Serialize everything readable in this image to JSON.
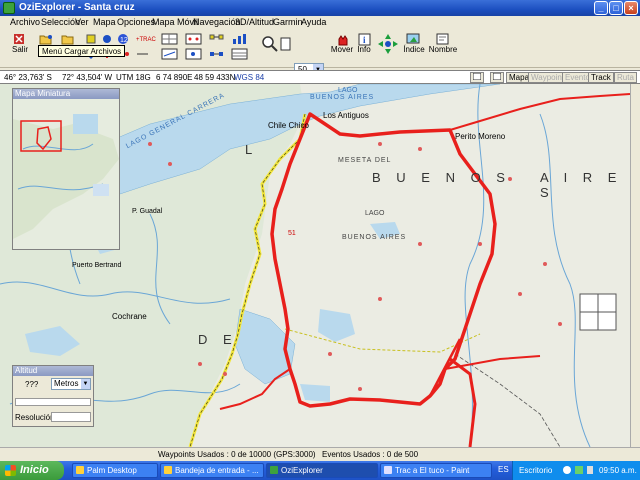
{
  "window": {
    "title": "OziExplorer - Santa cruz"
  },
  "menubar": {
    "items": [
      "Archivo",
      "Selección",
      "Ver",
      "Mapa",
      "Opciones",
      "Mapa Móvil",
      "Navegación",
      "3D/Altitud",
      "Garmin",
      "Ayuda"
    ]
  },
  "toolbar": {
    "salir": "Salir",
    "zoom_value": "50",
    "mover": "Mover",
    "info": "Info",
    "indice": "Índice",
    "nombre": "Nombre",
    "tooltip": "Menú Cargar Archivos"
  },
  "coordbar": {
    "lat": "46° 23,763' S",
    "lon": "72° 43,504' W",
    "utm": "UTM  18G",
    "easting": "6 74 890E",
    "northing": "48 59 433N",
    "datum": "WGS 84",
    "view_buttons": [
      "Mapa",
      "Waypoints",
      "Evento",
      "Track",
      "Ruta"
    ]
  },
  "minimap": {
    "title": "Mapa Miniatura"
  },
  "altitude": {
    "title": "Altitud",
    "value": "???",
    "unit": "Metros",
    "resolution_label": "Resolución"
  },
  "map_labels": {
    "lago": "LAGO",
    "buenos_aires": "BUENOS AIRES",
    "lago_general_carrera": "LAGO GENERAL CARRERA",
    "chile_chico": "Chile Chico",
    "los_antiguos": "Los Antiguos",
    "perito_moreno": "Perito Moreno",
    "meseta": "MESETA DEL",
    "lago2": "LAGO",
    "buenos_aires2": "BUENOS AIRES",
    "buenos_big": "B U E N O S",
    "aires_big": "A I R E S",
    "cochrane": "Cochrane",
    "puerto_guadal": "P. Guadal",
    "puerto_bertrand": "Puerto Bertrand",
    "de_big": "D E",
    "l_big": "L",
    "num_51": "51"
  },
  "statusbar": {
    "waypoints": "Waypoints Usados : 0 de 10000  (GPS:3000)",
    "events": "Eventos Usados : 0 de 500"
  },
  "taskbar": {
    "start": "Inicio",
    "tasks": [
      "Palm Desktop",
      "Bandeja de entrada - ...",
      "OziExplorer",
      "Trac a El tuco - Paint"
    ],
    "lang": "ES",
    "desktop": "Escritorio",
    "clock": "09:50 a.m."
  }
}
